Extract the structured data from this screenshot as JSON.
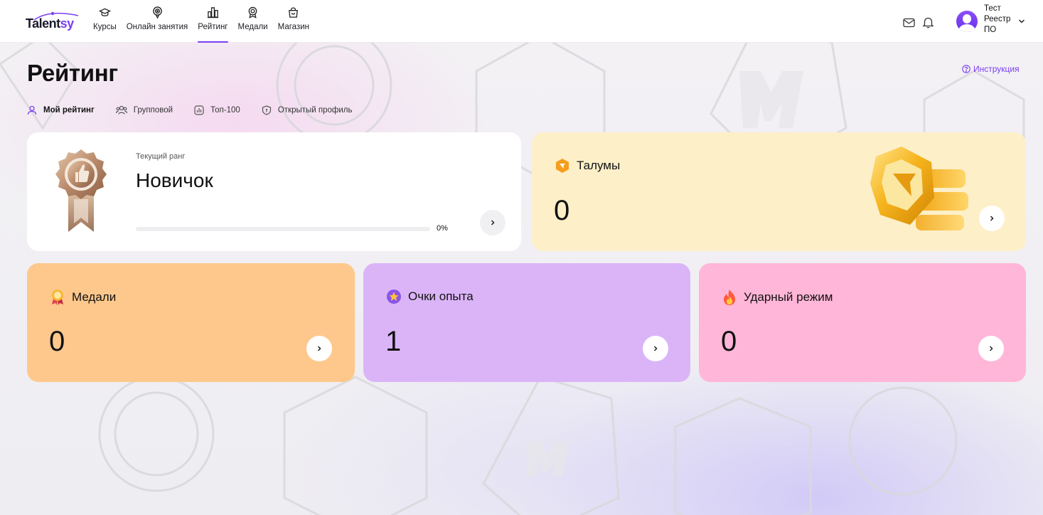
{
  "app": {
    "logo_text_main": "Talent",
    "logo_text_accent": "sy"
  },
  "nav": {
    "items": [
      {
        "label": "Курсы",
        "icon": "graduation-cap-icon"
      },
      {
        "label": "Онлайн занятия",
        "icon": "broadcast-icon"
      },
      {
        "label": "Рейтинг",
        "icon": "bar-chart-icon",
        "active": true
      },
      {
        "label": "Медали",
        "icon": "medal-icon"
      },
      {
        "label": "Магазин",
        "icon": "shopping-bag-icon"
      }
    ]
  },
  "header": {
    "mail_icon": "mail-icon",
    "bell_icon": "bell-icon",
    "user": {
      "line1": "Тест",
      "line2": "Реестр",
      "line3": "ПО"
    }
  },
  "page": {
    "title": "Рейтинг",
    "instruction_label": "Инструкция",
    "tabs": [
      {
        "label": "Мой рейтинг",
        "icon": "user-icon",
        "active": true
      },
      {
        "label": "Групповой",
        "icon": "users-icon"
      },
      {
        "label": "Топ-100",
        "icon": "chart-icon"
      },
      {
        "label": "Открытый профиль",
        "icon": "shield-icon"
      }
    ]
  },
  "rank_card": {
    "label": "Текущий ранг",
    "value": "Новичок",
    "progress_percent": 0,
    "progress_label": "0%"
  },
  "talum_card": {
    "title": "Талумы",
    "value": "0"
  },
  "medal_card": {
    "title": "Медали",
    "value": "0"
  },
  "xp_card": {
    "title": "Очки опыта",
    "value": "1"
  },
  "streak_card": {
    "title": "Ударный режим",
    "value": "0"
  },
  "colors": {
    "accent": "#7b3ff2",
    "talum_bg": "#fdefc8",
    "medal_bg": "#fec88d",
    "xp_bg": "#dbb4f8",
    "streak_bg": "#ffb6d8"
  }
}
